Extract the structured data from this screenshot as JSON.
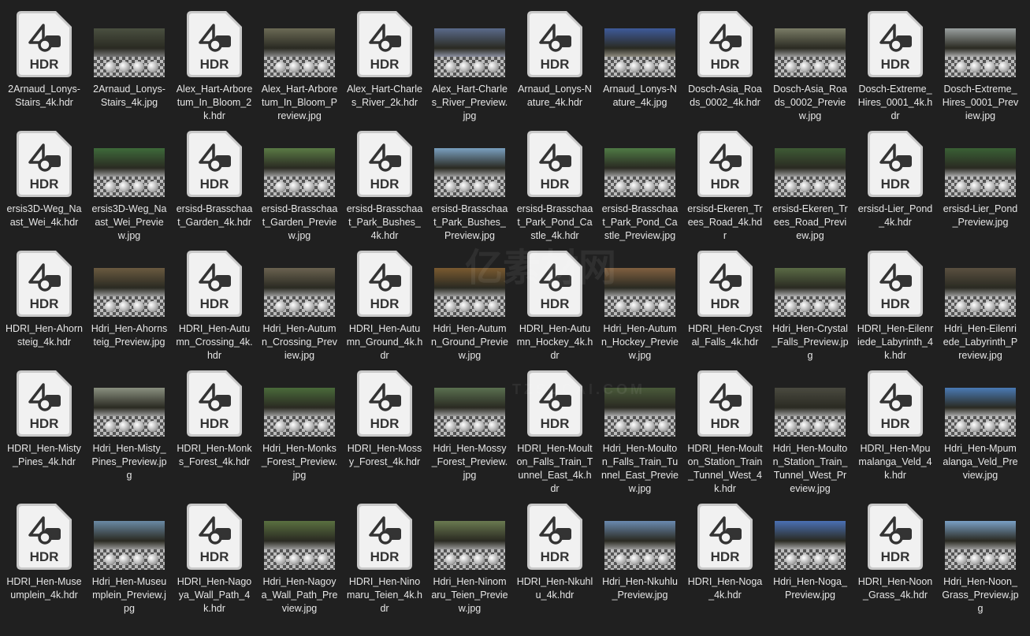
{
  "watermark": {
    "text": "亿素材网",
    "sub": "TZSUCAI.COM"
  },
  "file_icon": {
    "badge": "HDR",
    "color": "#f1f1f1"
  },
  "files": [
    {
      "name": "2Arnaud_Lonys-Stairs_4k.hdr",
      "type": "hdr"
    },
    {
      "name": "2Arnaud_Lonys-Stairs_4k.jpg",
      "type": "jpg",
      "sky": "#4a5040",
      "ground": "#777"
    },
    {
      "name": "Alex_Hart-Arboretum_In_Bloom_2k.hdr",
      "type": "hdr"
    },
    {
      "name": "Alex_Hart-Arboretum_In_Bloom_Preview.jpg",
      "type": "jpg",
      "sky": "#6b6a55",
      "ground": "#888"
    },
    {
      "name": "Alex_Hart-Charles_River_2k.hdr",
      "type": "hdr"
    },
    {
      "name": "Alex_Hart-Charles_River_Preview.jpg",
      "type": "jpg",
      "sky": "#5a6a8a",
      "ground": "#8a8fa0"
    },
    {
      "name": "Arnaud_Lonys-Nature_4k.hdr",
      "type": "hdr"
    },
    {
      "name": "Arnaud_Lonys-Nature_4k.jpg",
      "type": "jpg",
      "sky": "#3e5a9a",
      "ground": "#8f8b80"
    },
    {
      "name": "Dosch-Asia_Roads_0002_4k.hdr",
      "type": "hdr"
    },
    {
      "name": "Dosch-Asia_Roads_0002_Preview.jpg",
      "type": "jpg",
      "sky": "#7a7c66",
      "ground": "#999"
    },
    {
      "name": "Dosch-Extreme_Hires_0001_4k.hdr",
      "type": "hdr"
    },
    {
      "name": "Dosch-Extreme_Hires_0001_Preview.jpg",
      "type": "jpg",
      "sky": "#9aa0a0",
      "ground": "#aaa"
    },
    {
      "name": "ersis3D-Weg_Naast_Wei_4k.hdr",
      "type": "hdr"
    },
    {
      "name": "ersis3D-Weg_Naast_Wei_Preview.jpg",
      "type": "jpg",
      "sky": "#3e6a3a",
      "ground": "#999"
    },
    {
      "name": "ersisd-Brasschaat_Garden_4k.hdr",
      "type": "hdr"
    },
    {
      "name": "ersisd-Brasschaat_Garden_Preview.jpg",
      "type": "jpg",
      "sky": "#5a7a45",
      "ground": "#999"
    },
    {
      "name": "ersisd-Brasschaat_Park_Bushes_4k.hdr",
      "type": "hdr"
    },
    {
      "name": "ersisd-Brasschaat_Park_Bushes_Preview.jpg",
      "type": "jpg",
      "sky": "#7aa0c0",
      "ground": "#9a9a9a"
    },
    {
      "name": "ersisd-Brasschaat_Park_Pond_Castle_4k.hdr",
      "type": "hdr"
    },
    {
      "name": "ersisd-Brasschaat_Park_Pond_Castle_Preview.jpg",
      "type": "jpg",
      "sky": "#4f7a45",
      "ground": "#999"
    },
    {
      "name": "ersisd-Ekeren_Trees_Road_4k.hdr",
      "type": "hdr"
    },
    {
      "name": "ersisd-Ekeren_Trees_Road_Preview.jpg",
      "type": "jpg",
      "sky": "#3e5a35",
      "ground": "#999"
    },
    {
      "name": "ersisd-Lier_Pond_4k.hdr",
      "type": "hdr"
    },
    {
      "name": "ersisd-Lier_Pond_Preview.jpg",
      "type": "jpg",
      "sky": "#3a6035",
      "ground": "#aaa"
    },
    {
      "name": "HDRI_Hen-Ahornsteig_4k.hdr",
      "type": "hdr"
    },
    {
      "name": "Hdri_Hen-Ahornsteig_Preview.jpg",
      "type": "jpg",
      "sky": "#6a5a40",
      "ground": "#999"
    },
    {
      "name": "HDRI_Hen-Autumn_Crossing_4k.hdr",
      "type": "hdr"
    },
    {
      "name": "Hdri_Hen-Autumn_Crossing_Preview.jpg",
      "type": "jpg",
      "sky": "#6a6250",
      "ground": "#999"
    },
    {
      "name": "HDRI_Hen-Autumn_Ground_4k.hdr",
      "type": "hdr"
    },
    {
      "name": "Hdri_Hen-Autumn_Ground_Preview.jpg",
      "type": "jpg",
      "sky": "#7a5a30",
      "ground": "#999"
    },
    {
      "name": "HDRI_Hen-Autumn_Hockey_4k.hdr",
      "type": "hdr"
    },
    {
      "name": "Hdri_Hen-Autumn_Hockey_Preview.jpg",
      "type": "jpg",
      "sky": "#806040",
      "ground": "#999"
    },
    {
      "name": "HDRI_Hen-Crystal_Falls_4k.hdr",
      "type": "hdr"
    },
    {
      "name": "Hdri_Hen-Crystal_Falls_Preview.jpg",
      "type": "jpg",
      "sky": "#5a6a45",
      "ground": "#aaa"
    },
    {
      "name": "HDRI_Hen-Eilenriede_Labyrinth_4k.hdr",
      "type": "hdr"
    },
    {
      "name": "Hdri_Hen-Eilenriede_Labyrinth_Preview.jpg",
      "type": "jpg",
      "sky": "#5a5040",
      "ground": "#999"
    },
    {
      "name": "HDRI_Hen-Misty_Pines_4k.hdr",
      "type": "hdr"
    },
    {
      "name": "Hdri_Hen-Misty_Pines_Preview.jpg",
      "type": "jpg",
      "sky": "#8a9080",
      "ground": "#999"
    },
    {
      "name": "HDRI_Hen-Monks_Forest_4k.hdr",
      "type": "hdr"
    },
    {
      "name": "Hdri_Hen-Monks_Forest_Preview.jpg",
      "type": "jpg",
      "sky": "#4a6a3a",
      "ground": "#999"
    },
    {
      "name": "HDRI_Hen-Mossy_Forest_4k.hdr",
      "type": "hdr"
    },
    {
      "name": "Hdri_Hen-Mossy_Forest_Preview.jpg",
      "type": "jpg",
      "sky": "#5a7050",
      "ground": "#999"
    },
    {
      "name": "HDRI_Hen-Moulton_Falls_Train_Tunnel_East_4k.hdr",
      "type": "hdr"
    },
    {
      "name": "Hdri_Hen-Moulton_Falls_Train_Tunnel_East_Preview.jpg",
      "type": "jpg",
      "sky": "#4a5a3a",
      "ground": "#aaa"
    },
    {
      "name": "HDRI_Hen-Moulton_Station_Train_Tunnel_West_4k.hdr",
      "type": "hdr"
    },
    {
      "name": "Hdri_Hen-Moulton_Station_Train_Tunnel_West_Preview.jpg",
      "type": "jpg",
      "sky": "#4a4a40",
      "ground": "#999"
    },
    {
      "name": "HDRI_Hen-Mpumalanga_Veld_4k.hdr",
      "type": "hdr"
    },
    {
      "name": "Hdri_Hen-Mpumalanga_Veld_Preview.jpg",
      "type": "jpg",
      "sky": "#4a7ab5",
      "ground": "#aaa"
    },
    {
      "name": "HDRI_Hen-Museumplein_4k.hdr",
      "type": "hdr"
    },
    {
      "name": "Hdri_Hen-Museumplein_Preview.jpg",
      "type": "jpg",
      "sky": "#6a8aa5",
      "ground": "#999"
    },
    {
      "name": "HDRI_Hen-Nagoya_Wall_Path_4k.hdr",
      "type": "hdr"
    },
    {
      "name": "Hdri_Hen-Nagoya_Wall_Path_Preview.jpg",
      "type": "jpg",
      "sky": "#5a7040",
      "ground": "#999"
    },
    {
      "name": "HDRI_Hen-Ninomaru_Teien_4k.hdr",
      "type": "hdr"
    },
    {
      "name": "Hdri_Hen-Ninomaru_Teien_Preview.jpg",
      "type": "jpg",
      "sky": "#6a7a50",
      "ground": "#999"
    },
    {
      "name": "HDRI_Hen-Nkuhlu_4k.hdr",
      "type": "hdr"
    },
    {
      "name": "Hdri_Hen-Nkuhlu_Preview.jpg",
      "type": "jpg",
      "sky": "#6a8ab0",
      "ground": "#999"
    },
    {
      "name": "HDRI_Hen-Noga_4k.hdr",
      "type": "hdr"
    },
    {
      "name": "Hdri_Hen-Noga_Preview.jpg",
      "type": "jpg",
      "sky": "#4a70b5",
      "ground": "#aaa"
    },
    {
      "name": "HDRI_Hen-Noon_Grass_4k.hdr",
      "type": "hdr"
    },
    {
      "name": "Hdri_Hen-Noon_Grass_Preview.jpg",
      "type": "jpg",
      "sky": "#7aa0c5",
      "ground": "#999"
    }
  ]
}
